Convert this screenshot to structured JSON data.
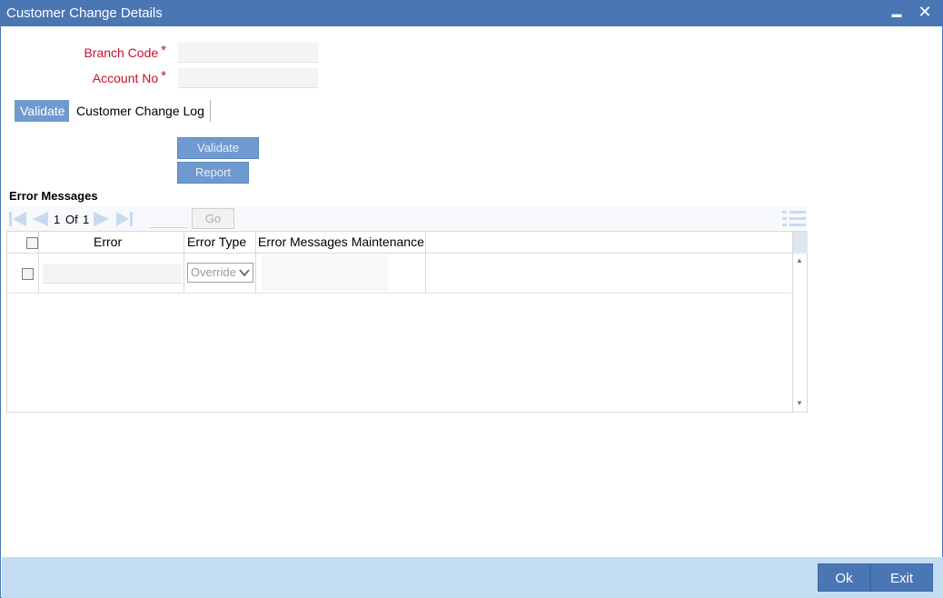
{
  "window": {
    "title": "Customer Change Details",
    "minimize_glyph": "▬",
    "close_glyph": "✕"
  },
  "form": {
    "branch_code_label": "Branch Code",
    "branch_code_value": "",
    "account_no_label": "Account No",
    "account_no_value": "",
    "required_marker": "*"
  },
  "tabs": [
    {
      "label": "Validate",
      "active": true
    },
    {
      "label": "Customer Change Log",
      "active": false
    }
  ],
  "actions": {
    "validate_label": "Validate",
    "report_label": "Report"
  },
  "error_section": {
    "title": "Error Messages",
    "pager": {
      "current": "1",
      "of_label": "Of",
      "total": "1",
      "go_value": "",
      "go_label": "Go"
    },
    "columns": [
      "Error",
      "Error Type",
      "Error Messages Maintenance"
    ],
    "rows": [
      {
        "error": "",
        "error_type": "Override",
        "maintenance": ""
      }
    ]
  },
  "footer": {
    "ok_label": "Ok",
    "exit_label": "Exit"
  },
  "colors": {
    "titlebar": "#4a76b4",
    "required_label": "#c8102e",
    "tab_active": "#6f9ad0",
    "footer": "#c4dcf2"
  }
}
